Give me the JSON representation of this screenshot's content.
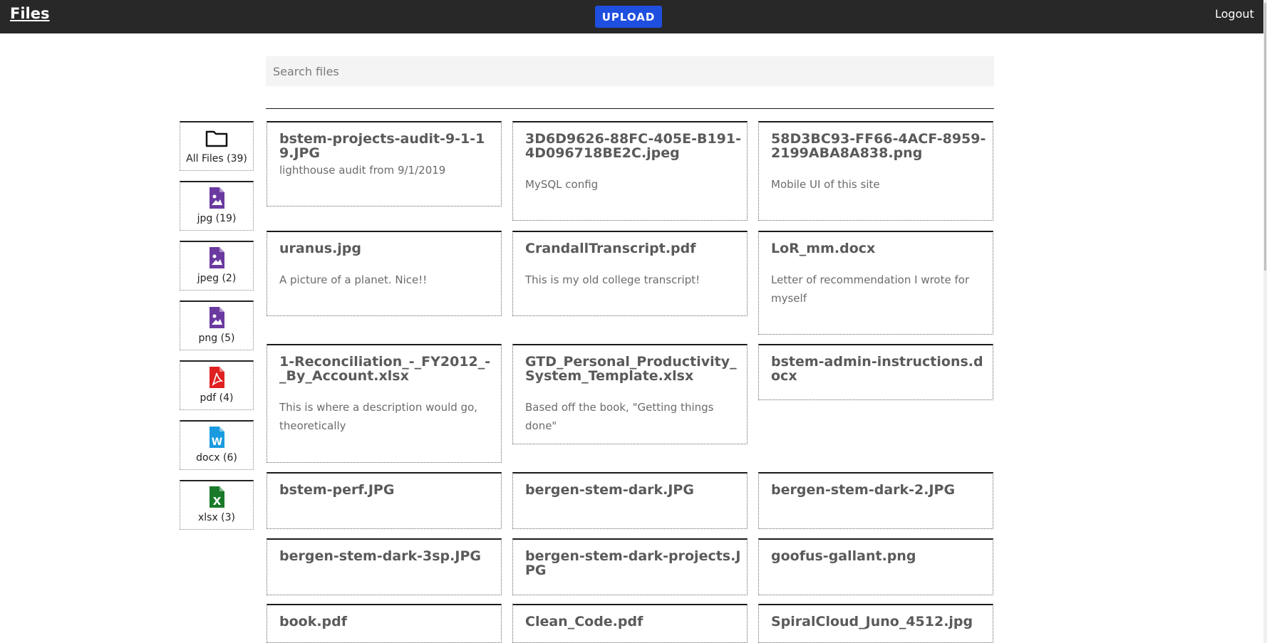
{
  "header": {
    "brand": "Files",
    "upload_label": "UPLOAD",
    "logout_label": "Logout"
  },
  "search": {
    "placeholder": "Search files",
    "value": ""
  },
  "sidebar": [
    {
      "label": "All Files (39)",
      "icon": "folder-icon"
    },
    {
      "label": "jpg (19)",
      "icon": "image-file-icon",
      "color": "#6b3aa0"
    },
    {
      "label": "jpeg (2)",
      "icon": "image-file-icon",
      "color": "#6b3aa0"
    },
    {
      "label": "png (5)",
      "icon": "image-file-icon",
      "color": "#6b3aa0"
    },
    {
      "label": "pdf (4)",
      "icon": "pdf-file-icon",
      "color": "#e02020"
    },
    {
      "label": "docx (6)",
      "icon": "word-file-icon",
      "color": "#1a9be0"
    },
    {
      "label": "xlsx (3)",
      "icon": "excel-file-icon",
      "color": "#1a7a2a"
    }
  ],
  "files": [
    {
      "name": "bstem-projects-audit-9-1-19.JPG",
      "description": "lighthouse audit from 9/1/2019"
    },
    {
      "name": "3D6D9626-88FC-405E-B191-4D096718BE2C.jpeg",
      "description": "MySQL config"
    },
    {
      "name": "58D3BC93-FF66-4ACF-8959-2199ABA8A838.png",
      "description": "Mobile UI of this site"
    },
    {
      "name": "uranus.jpg",
      "description": "A picture of a planet. Nice!!"
    },
    {
      "name": "CrandallTranscript.pdf",
      "description": "This is my old college transcript!"
    },
    {
      "name": "LoR_mm.docx",
      "description": "Letter of recommendation I wrote for myself"
    },
    {
      "name": "1-Reconciliation_-_FY2012_-_By_Account.xlsx",
      "description": "This is where a description would go, theoretically"
    },
    {
      "name": "GTD_Personal_Productivity_System_Template.xlsx",
      "description": "Based off the book, \"Getting things done\""
    },
    {
      "name": "bstem-admin-instructions.docx",
      "description": ""
    },
    {
      "name": "bstem-perf.JPG",
      "description": ""
    },
    {
      "name": "bergen-stem-dark.JPG",
      "description": ""
    },
    {
      "name": "bergen-stem-dark-2.JPG",
      "description": ""
    },
    {
      "name": "bergen-stem-dark-3sp.JPG",
      "description": ""
    },
    {
      "name": "bergen-stem-dark-projects.JPG",
      "description": ""
    },
    {
      "name": "goofus-gallant.png",
      "description": ""
    },
    {
      "name": "book.pdf",
      "description": ""
    },
    {
      "name": "Clean_Code.pdf",
      "description": ""
    },
    {
      "name": "SpiralCloud_Juno_4512.jpg",
      "description": ""
    }
  ]
}
